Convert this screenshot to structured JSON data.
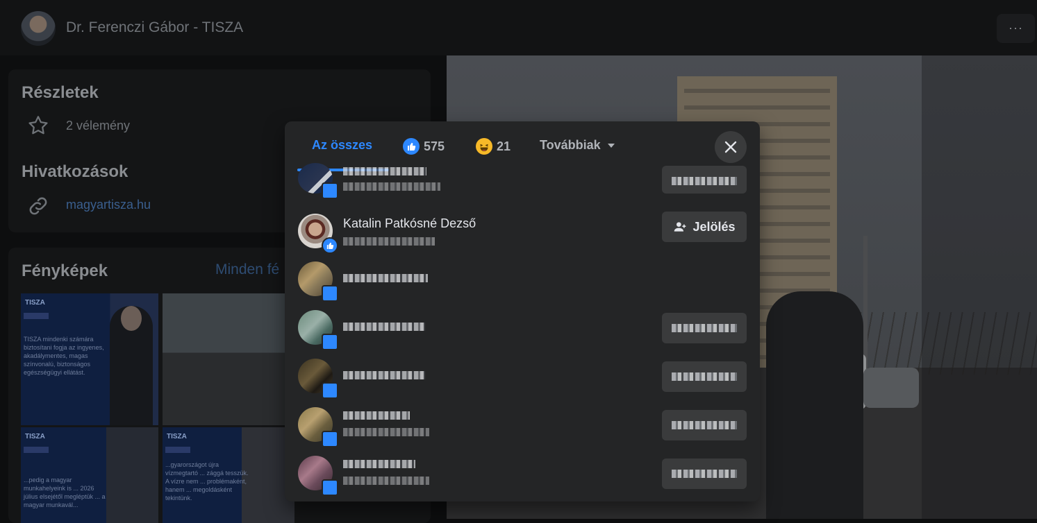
{
  "header": {
    "title": "Dr. Ferenczi Gábor - TISZA",
    "more": "···"
  },
  "details": {
    "heading": "Részletek",
    "reviews": "2 vélemény",
    "links_heading": "Hivatkozások",
    "link": "magyartisza.hu"
  },
  "photos": {
    "heading": "Fényképek",
    "see_all": "Minden fé",
    "thumbs": [
      {
        "brand": "TISZA",
        "text": "TISZA mindenki számára biztosítani fogja az ingyenes, akadálymentes, magas színvonalú, biztonságos egészségügyi ellátást."
      },
      {
        "brand": ""
      },
      {
        "brand": "TISZA",
        "text": "...pedig a magyar munkahelyeink is ... 2026 július elsejétől megléptük ... a magyar munkavál..."
      },
      {
        "brand": "TISZA",
        "text": "...gyarországot újra vízmegtartó ... zággá tesszük. A vízre nem ... problémaként, hanem ... megoldásként tekintünk."
      }
    ]
  },
  "modal": {
    "tabs": [
      {
        "label": "Az összes",
        "active": true
      },
      {
        "label": "575",
        "icon": "like-icon"
      },
      {
        "label": "21",
        "icon": "haha-icon"
      },
      {
        "label": "Továbbiak",
        "icon": "caret-down-icon"
      }
    ],
    "close_icon": "close-icon",
    "people": [
      {
        "name": "Katalin Patkósné Dezső",
        "button": "Jelölés",
        "reaction": "like"
      }
    ]
  },
  "colors": {
    "accent": "#2d88ff",
    "modal_bg": "#242526",
    "button_bg": "#3a3b3c",
    "haha": "#f7b928"
  }
}
